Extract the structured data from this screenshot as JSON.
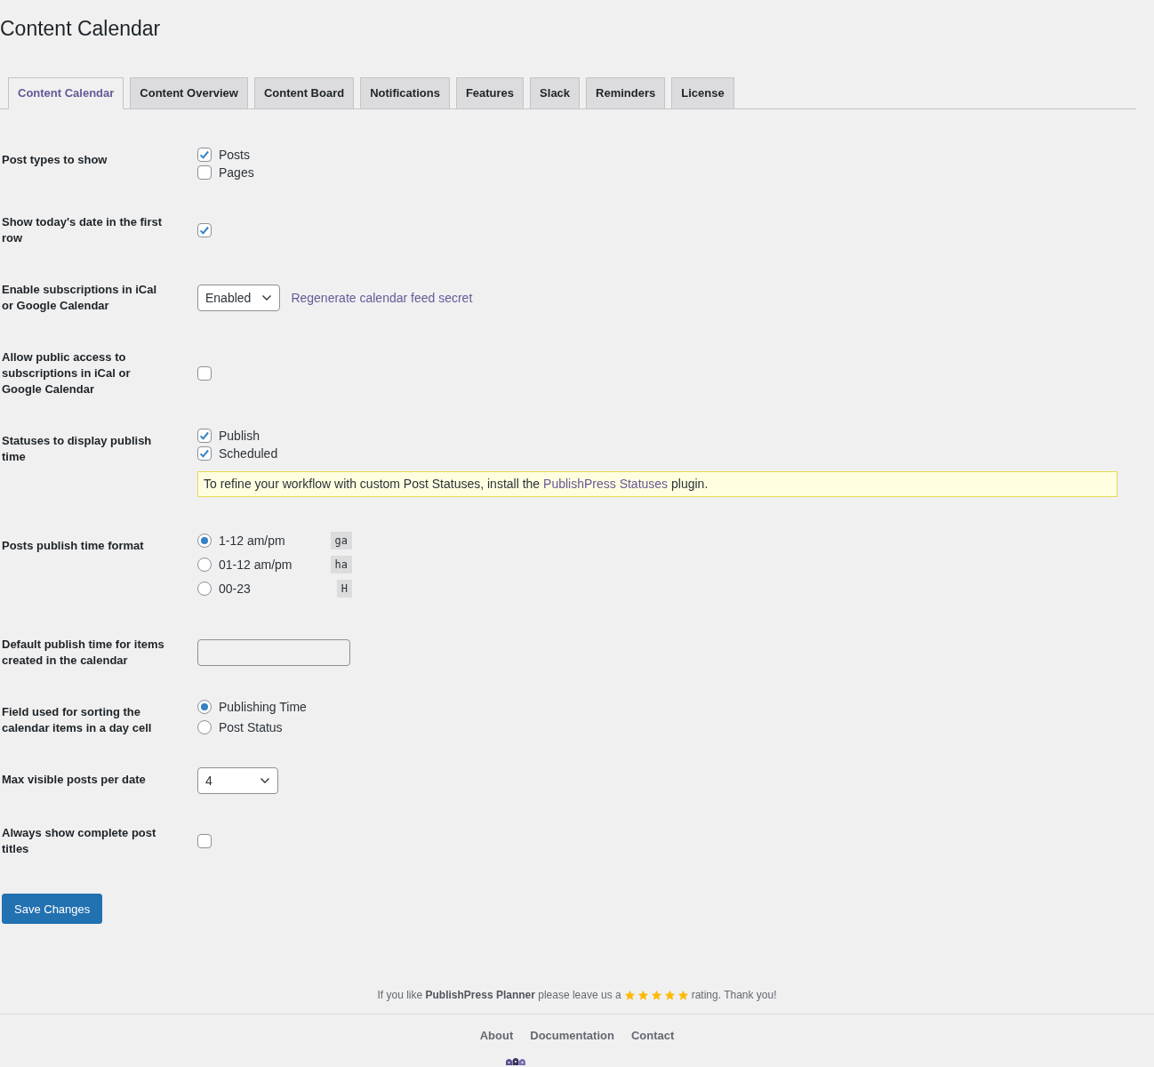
{
  "page": {
    "title": "Content Calendar"
  },
  "tabs": [
    {
      "label": "Content Calendar",
      "selected": true
    },
    {
      "label": "Content Overview",
      "selected": false
    },
    {
      "label": "Content Board",
      "selected": false
    },
    {
      "label": "Notifications",
      "selected": false
    },
    {
      "label": "Features",
      "selected": false
    },
    {
      "label": "Slack",
      "selected": false
    },
    {
      "label": "Reminders",
      "selected": false
    },
    {
      "label": "License",
      "selected": false
    }
  ],
  "settings": [
    {
      "kind": "checkbox_list",
      "label": "Post types to show",
      "options": [
        {
          "label": "Posts",
          "checked": true
        },
        {
          "label": "Pages",
          "checked": false
        }
      ]
    },
    {
      "kind": "checkbox",
      "label": "Show today's date in the first row",
      "checked": true
    },
    {
      "kind": "select",
      "label": "Enable subscriptions in iCal or Google Calendar",
      "value": "Enabled",
      "link": "Regenerate calendar feed secret"
    },
    {
      "kind": "checkbox",
      "label": "Allow public access to subscriptions in iCal or Google Calendar",
      "checked": false
    },
    {
      "kind": "checkbox_list",
      "label": "Statuses to display publish time",
      "options": [
        {
          "label": "Publish",
          "checked": true
        },
        {
          "label": "Scheduled",
          "checked": true
        }
      ],
      "notice": {
        "text_before": "To refine your workflow with custom Post Statuses, install the",
        "link": "PublishPress Statuses",
        "text_after": "plugin."
      }
    },
    {
      "kind": "radio_list",
      "label": "Posts publish time format",
      "options": [
        {
          "label": "1-12 am/pm",
          "code": "ga",
          "selected": true
        },
        {
          "label": "01-12 am/pm",
          "code": "ha",
          "selected": false
        },
        {
          "label": "00-23",
          "code": "H",
          "selected": false
        }
      ]
    },
    {
      "kind": "text_field",
      "label": "Default publish time for items created in the calendar"
    },
    {
      "kind": "radio_list",
      "label": "Field used for sorting the calendar items in a day cell",
      "options": [
        {
          "label": "Publishing Time",
          "selected": true
        },
        {
          "label": "Post Status",
          "selected": false
        }
      ]
    },
    {
      "kind": "select",
      "label": "Max visible posts per date",
      "value": "4"
    },
    {
      "kind": "checkbox",
      "label": "Always show complete post titles",
      "checked": false
    }
  ],
  "save_button": {
    "label": "Save Changes"
  },
  "footer": {
    "rating": {
      "text_before": "If you like **PublishPress Planner** please leave us a",
      "stars": 5,
      "text_after": "rating. Thank you!"
    },
    "links": [
      "About",
      "Documentation",
      "Contact"
    ]
  }
}
